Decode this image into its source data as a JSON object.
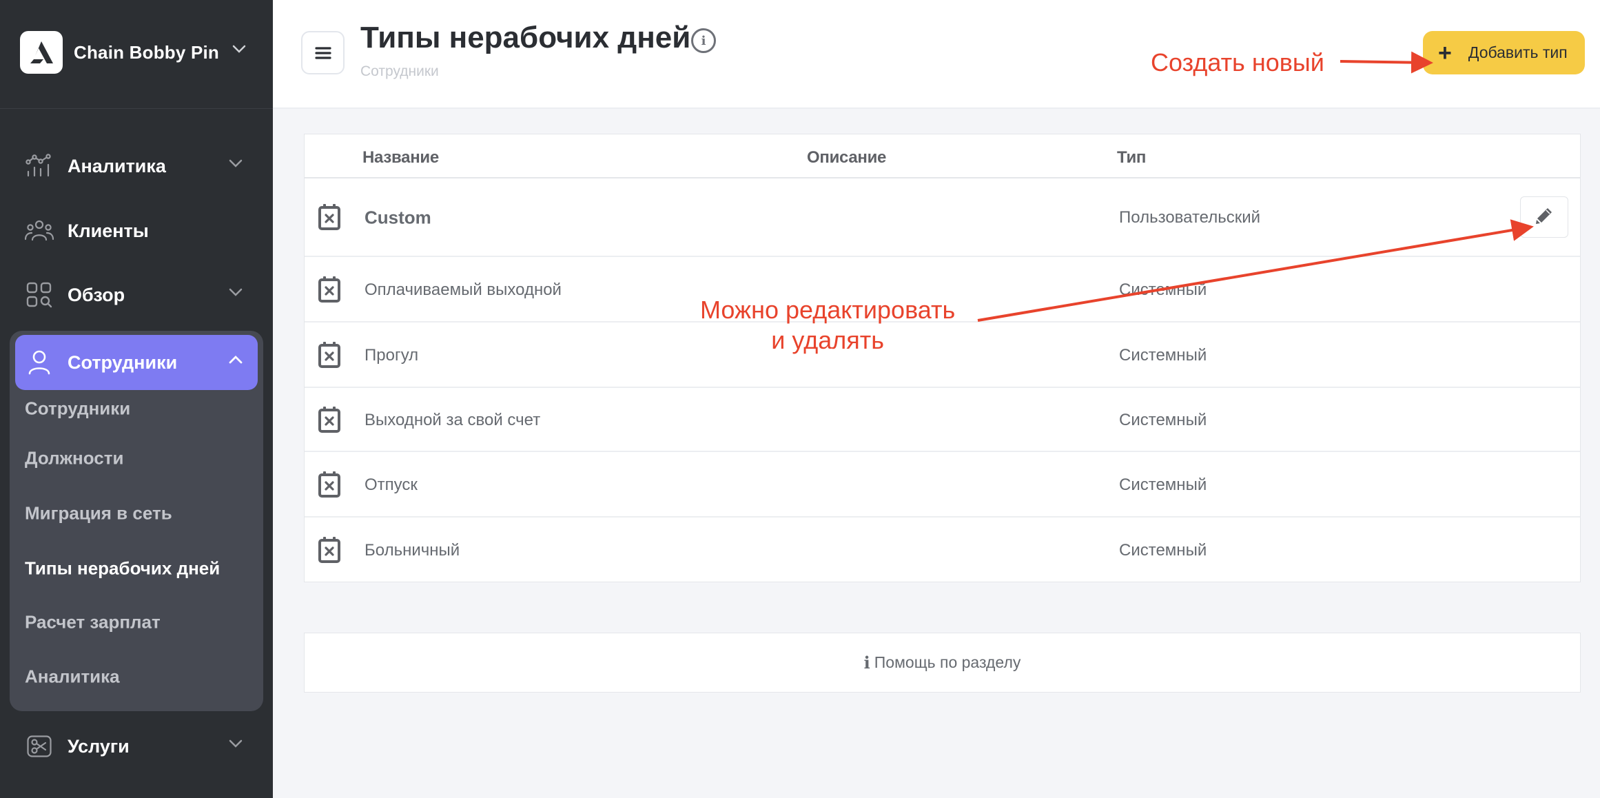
{
  "sidebar": {
    "brand": {
      "name": "Chain Bobby Pin",
      "icon": "logo-triangle",
      "chevron": "chevron-down-icon"
    },
    "items": [
      {
        "label": "Аналитика",
        "icon": "analytics-chart-icon",
        "expandable": true
      },
      {
        "label": "Клиенты",
        "icon": "clients-users-icon",
        "expandable": false
      },
      {
        "label": "Обзор",
        "icon": "overview-grid-search-icon",
        "expandable": true
      },
      {
        "label": "Сотрудники",
        "icon": "user-icon",
        "expandable": true,
        "active": true,
        "expanded": true
      },
      {
        "label": "Услуги",
        "icon": "scissors-icon",
        "expandable": true
      }
    ],
    "subitems": [
      {
        "label": "Сотрудники"
      },
      {
        "label": "Должности"
      },
      {
        "label": "Миграция в сеть"
      },
      {
        "label": "Типы нерабочих дней",
        "current": true
      },
      {
        "label": "Расчет зарплат"
      },
      {
        "label": "Аналитика"
      }
    ]
  },
  "header": {
    "title": "Типы нерабочих дней",
    "breadcrumb": "Сотрудники",
    "info_icon": "i",
    "add_button": {
      "icon": "+",
      "label": "Добавить тип"
    }
  },
  "annotations": {
    "create": "Создать новый",
    "edit_line1": "Можно редактировать",
    "edit_line2": "и удалять"
  },
  "table": {
    "columns": [
      "Название",
      "Описание",
      "Тип"
    ],
    "rows": [
      {
        "name": "Custom",
        "description": "",
        "type": "Пользовательский",
        "editable": true
      },
      {
        "name": "Оплачиваемый выходной",
        "description": "",
        "type": "Системный",
        "editable": false
      },
      {
        "name": "Прогул",
        "description": "",
        "type": "Системный",
        "editable": false
      },
      {
        "name": "Выходной за свой счет",
        "description": "",
        "type": "Системный",
        "editable": false
      },
      {
        "name": "Отпуск",
        "description": "",
        "type": "Системный",
        "editable": false
      },
      {
        "name": "Больничный",
        "description": "",
        "type": "Системный",
        "editable": false
      }
    ]
  },
  "help": {
    "icon": "i",
    "label": "Помощь по разделу"
  },
  "colors": {
    "sidebar_bg": "#2c2f33",
    "active_item": "#7e7bf2",
    "group_bg": "#464952",
    "add_button": "#f6cb45",
    "annotation": "#e8432c"
  }
}
